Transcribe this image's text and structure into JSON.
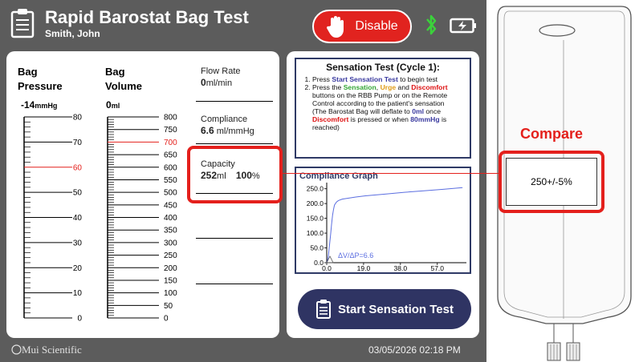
{
  "header": {
    "title": "Rapid Barostat Bag Test",
    "patient": "Smith, John",
    "disable_label": "Disable",
    "bluetooth_icon": "bluetooth-icon",
    "battery_icon": "battery-icon",
    "colors": {
      "disable": "#e1231f",
      "background": "#5c5c5c"
    }
  },
  "gauges": {
    "pressure": {
      "title_line1": "Bag",
      "title_line2": "Pressure",
      "value": "-14",
      "unit": "mmHg",
      "ticks": [
        "80",
        "70",
        "60",
        "50",
        "40",
        "30",
        "20",
        "10",
        "0"
      ],
      "highlight_tick": "60",
      "highlight_color": "#e4201c"
    },
    "volume": {
      "title_line1": "Bag",
      "title_line2": "Volume",
      "value": "0",
      "unit": "ml",
      "ticks": [
        "800",
        "750",
        "700",
        "650",
        "600",
        "550",
        "500",
        "450",
        "400",
        "350",
        "300",
        "250",
        "200",
        "150",
        "100",
        "50",
        "0"
      ],
      "highlight_tick": "700",
      "highlight_color": "#e4201c"
    }
  },
  "readouts": {
    "flow_rate_label": "Flow Rate",
    "flow_rate_value": "0",
    "flow_rate_unit": "ml/min",
    "compliance_label": "Compliance",
    "compliance_value": "6.6",
    "compliance_unit": "ml/mmHg",
    "capacity_label": "Capacity",
    "capacity_value": "252",
    "capacity_unit": "ml",
    "capacity_percent": "100",
    "capacity_percent_unit": "%"
  },
  "sensation": {
    "title": "Sensation Test (Cycle 1):",
    "s1_pre": "Press ",
    "s1_hl": "Start Sensation Test",
    "s1_post": " to begin test",
    "s2_a": "Press the ",
    "s2_sensation": "Sensation",
    "s2_b": ", ",
    "s2_urge": "Urge",
    "s2_c": " and ",
    "s2_discomfort": "Discomfort",
    "s2_d": " buttons on the RBB Pump or on the Remote Control according to the patient's sensation",
    "note_a": "(The Barostat Bag will deflate to ",
    "note_0ml": "0ml",
    "note_b": " once ",
    "note_discomfort": "Discomfort",
    "note_c": " is pressed or when ",
    "note_80": "80mmHg",
    "note_d": " is reached)"
  },
  "chart_data": {
    "type": "line",
    "title": "Compliance Graph",
    "xlabel": "",
    "ylabel": "",
    "xlim": [
      0,
      72
    ],
    "ylim": [
      0,
      260
    ],
    "x_ticks": [
      "0.0",
      "19.0",
      "38.0",
      "57.0"
    ],
    "y_ticks": [
      "250.0",
      "200.0",
      "150.0",
      "100.0",
      "50.0",
      "0.0"
    ],
    "annotation": "ΔV/ΔP=6.6",
    "series": [
      {
        "color": "#5b6ee0",
        "x": [
          0,
          0.4,
          0.8,
          1.2,
          1.6,
          2.0,
          2.5,
          3.0,
          3.5,
          4.0,
          5.0,
          6.0,
          8.0,
          11.0,
          15.0,
          20.0,
          30.0,
          40.0,
          50.0,
          60.0,
          70.0
        ],
        "y": [
          0,
          8,
          20,
          45,
          70,
          95,
          130,
          160,
          180,
          195,
          205,
          210,
          215,
          218,
          222,
          226,
          232,
          238,
          243,
          248,
          254
        ]
      }
    ]
  },
  "start_button_label": "Start Sensation Test",
  "footer": {
    "brand": "Mui Scientific",
    "datetime": "03/05/2026 02:18 PM"
  },
  "compare": {
    "label": "Compare",
    "spec": "250+/-5%",
    "color": "#e4201c"
  }
}
